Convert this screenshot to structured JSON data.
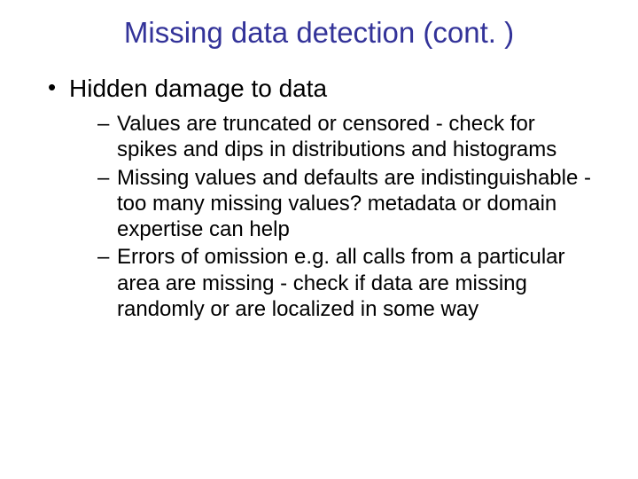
{
  "title": "Missing data detection (cont. )",
  "bullets": [
    {
      "text": "Hidden damage to data",
      "sub": [
        "Values are truncated or censored - check for spikes and dips in distributions and histograms",
        "Missing values and defaults are indistinguishable - too many missing values? metadata or domain expertise can help",
        "Errors of omission e.g. all calls from a particular area are missing - check if data are missing randomly or are localized in some way"
      ]
    }
  ]
}
